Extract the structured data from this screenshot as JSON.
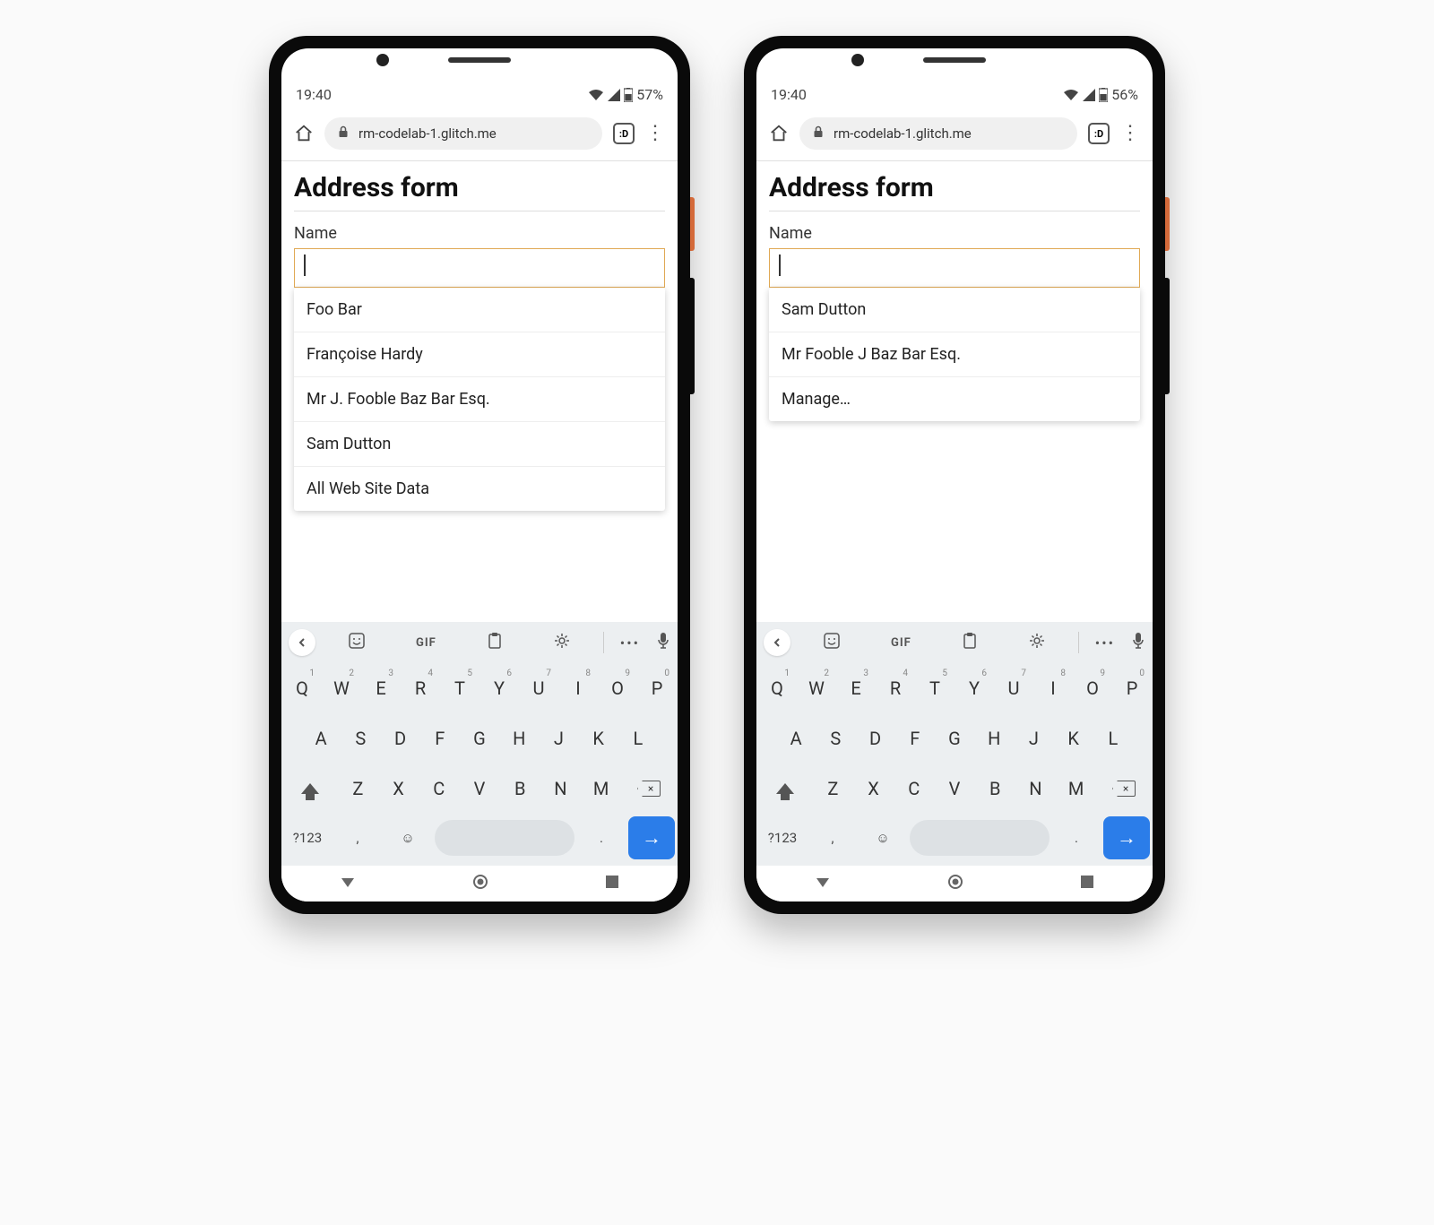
{
  "phones": [
    {
      "status": {
        "time": "19:40",
        "battery": "57%"
      },
      "browser": {
        "url": "rm-codelab-1.glitch.me",
        "tabs_badge": ":D"
      },
      "page": {
        "title": "Address form",
        "field_label": "Name",
        "dropdown": [
          "Foo Bar",
          "Françoise Hardy",
          "Mr J. Fooble Baz Bar Esq.",
          "Sam Dutton",
          "All Web Site Data"
        ]
      }
    },
    {
      "status": {
        "time": "19:40",
        "battery": "56%"
      },
      "browser": {
        "url": "rm-codelab-1.glitch.me",
        "tabs_badge": ":D"
      },
      "page": {
        "title": "Address form",
        "field_label": "Name",
        "dropdown": [
          "Sam Dutton",
          "Mr Fooble J Baz Bar Esq.",
          "Manage…"
        ]
      }
    }
  ],
  "keyboard": {
    "suggest_gif": "GIF",
    "row1": [
      {
        "l": "Q",
        "s": "1"
      },
      {
        "l": "W",
        "s": "2"
      },
      {
        "l": "E",
        "s": "3"
      },
      {
        "l": "R",
        "s": "4"
      },
      {
        "l": "T",
        "s": "5"
      },
      {
        "l": "Y",
        "s": "6"
      },
      {
        "l": "U",
        "s": "7"
      },
      {
        "l": "I",
        "s": "8"
      },
      {
        "l": "O",
        "s": "9"
      },
      {
        "l": "P",
        "s": "0"
      }
    ],
    "row2": [
      "A",
      "S",
      "D",
      "F",
      "G",
      "H",
      "J",
      "K",
      "L"
    ],
    "row3": [
      "Z",
      "X",
      "C",
      "V",
      "B",
      "N",
      "M"
    ],
    "sym": "?123",
    "comma": ",",
    "period": ".",
    "enter": "→"
  }
}
